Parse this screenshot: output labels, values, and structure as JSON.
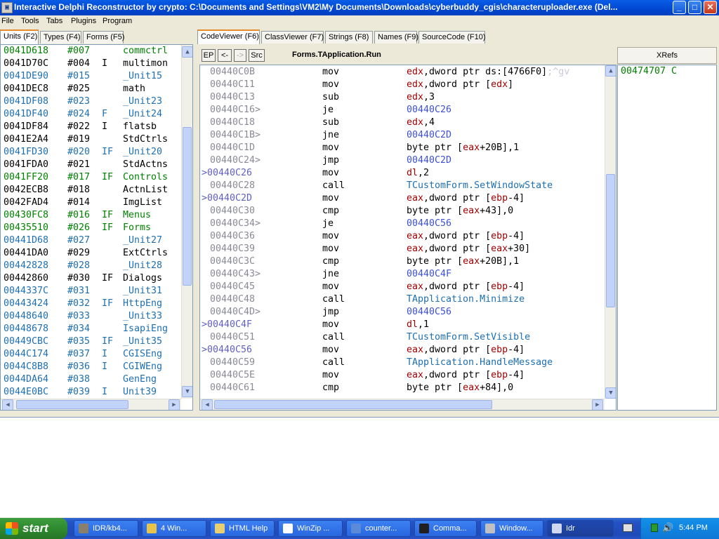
{
  "window": {
    "title": "Interactive Delphi Reconstructor by crypto: C:\\Documents and Settings\\VM2\\My Documents\\Downloads\\cyberbuddy_cgis\\characteruploader.exe (Del...",
    "minimize": "_",
    "maximize": "□",
    "close": "✕"
  },
  "menu": [
    "File",
    "Tools",
    "Tabs",
    "Plugins",
    "Program"
  ],
  "left_tabs": [
    "Units (F2)",
    "Types (F4)",
    "Forms (F5)"
  ],
  "units": [
    {
      "addr": "0041D618",
      "num": "#007",
      "flag": " ",
      "name": "commctrl",
      "color": "#008000"
    },
    {
      "addr": "0041D70C",
      "num": "#004",
      "flag": "I",
      "name": "multimon",
      "color": "#000000"
    },
    {
      "addr": "0041DE90",
      "num": "#015",
      "flag": " ",
      "name": "_Unit15",
      "color": "#1e6fb0"
    },
    {
      "addr": "0041DEC8",
      "num": "#025",
      "flag": " ",
      "name": "math",
      "color": "#000000"
    },
    {
      "addr": "0041DF08",
      "num": "#023",
      "flag": " ",
      "name": "_Unit23",
      "color": "#1e6fb0"
    },
    {
      "addr": "0041DF40",
      "num": "#024",
      "flag": "F",
      "name": "_Unit24",
      "color": "#1e6fb0"
    },
    {
      "addr": "0041DF84",
      "num": "#022",
      "flag": "I",
      "name": "flatsb",
      "color": "#000000"
    },
    {
      "addr": "0041E2A4",
      "num": "#019",
      "flag": " ",
      "name": "StdCtrls",
      "color": "#000000"
    },
    {
      "addr": "0041FD30",
      "num": "#020",
      "flag": "IF",
      "name": "_Unit20",
      "color": "#1e6fb0"
    },
    {
      "addr": "0041FDA0",
      "num": "#021",
      "flag": " ",
      "name": "StdActns",
      "color": "#000000"
    },
    {
      "addr": "0041FF20",
      "num": "#017",
      "flag": "IF",
      "name": "Controls",
      "color": "#008000"
    },
    {
      "addr": "0042ECB8",
      "num": "#018",
      "flag": " ",
      "name": "ActnList",
      "color": "#000000"
    },
    {
      "addr": "0042FAD4",
      "num": "#014",
      "flag": " ",
      "name": "ImgList",
      "color": "#000000"
    },
    {
      "addr": "00430FC8",
      "num": "#016",
      "flag": "IF",
      "name": "Menus",
      "color": "#008000"
    },
    {
      "addr": "00435510",
      "num": "#026",
      "flag": "IF",
      "name": "Forms",
      "color": "#008000"
    },
    {
      "addr": "00441D68",
      "num": "#027",
      "flag": " ",
      "name": "_Unit27",
      "color": "#1e6fb0"
    },
    {
      "addr": "00441DA0",
      "num": "#029",
      "flag": " ",
      "name": "ExtCtrls",
      "color": "#000000"
    },
    {
      "addr": "00442828",
      "num": "#028",
      "flag": " ",
      "name": "_Unit28",
      "color": "#1e6fb0"
    },
    {
      "addr": "00442860",
      "num": "#030",
      "flag": "IF",
      "name": "Dialogs",
      "color": "#000000"
    },
    {
      "addr": "0044337C",
      "num": "#031",
      "flag": " ",
      "name": "_Unit31",
      "color": "#1e6fb0"
    },
    {
      "addr": "00443424",
      "num": "#032",
      "flag": "IF",
      "name": "HttpEng",
      "color": "#1e6fb0"
    },
    {
      "addr": "00448640",
      "num": "#033",
      "flag": " ",
      "name": "_Unit33",
      "color": "#1e6fb0"
    },
    {
      "addr": "00448678",
      "num": "#034",
      "flag": " ",
      "name": "IsapiEng",
      "color": "#1e6fb0"
    },
    {
      "addr": "00449CBC",
      "num": "#035",
      "flag": "IF",
      "name": "_Unit35",
      "color": "#1e6fb0"
    },
    {
      "addr": "0044C174",
      "num": "#037",
      "flag": "I",
      "name": "CGISEng",
      "color": "#1e6fb0"
    },
    {
      "addr": "0044C8B8",
      "num": "#036",
      "flag": "I",
      "name": "CGIWEng",
      "color": "#1e6fb0"
    },
    {
      "addr": "0044DA64",
      "num": "#038",
      "flag": " ",
      "name": "GenEng",
      "color": "#1e6fb0"
    },
    {
      "addr": "0044E0BC",
      "num": "#039",
      "flag": "I",
      "name": "Unit39",
      "color": "#1e6fb0"
    }
  ],
  "right_tabs": [
    "CodeViewer (F6)",
    "ClassViewer (F7)",
    "Strings (F8)",
    "Names (F9)",
    "SourceCode (F10)"
  ],
  "toolbar": {
    "ep": "EP",
    "back": "<-",
    "fwd": "->",
    "src": "Src",
    "proc_name": "Forms.TApplication.Run"
  },
  "xrefs": {
    "header": "XRefs",
    "items": [
      "00474707 C"
    ]
  },
  "code": [
    {
      "addr": "00440C0B",
      "target": false,
      "op": "mov",
      "args": [
        [
          "reg",
          "edx"
        ],
        [
          "op",
          ",dword ptr "
        ],
        [
          "op",
          "ds:["
        ],
        [
          "num",
          "4766F0"
        ],
        [
          "op",
          "]"
        ],
        [
          "dim",
          ";^gv"
        ]
      ]
    },
    {
      "addr": "00440C11",
      "target": false,
      "op": "mov",
      "args": [
        [
          "reg",
          "edx"
        ],
        [
          "op",
          ",dword ptr ["
        ],
        [
          "reg",
          "edx"
        ],
        [
          "op",
          "]"
        ]
      ]
    },
    {
      "addr": "00440C13",
      "target": false,
      "op": "sub",
      "args": [
        [
          "reg",
          "edx"
        ],
        [
          "op",
          ","
        ],
        [
          "num",
          "3"
        ]
      ]
    },
    {
      "addr": "00440C16>",
      "target": false,
      "op": "je",
      "args": [
        [
          "lbl",
          "00440C26"
        ]
      ]
    },
    {
      "addr": "00440C18",
      "target": false,
      "op": "sub",
      "args": [
        [
          "reg",
          "edx"
        ],
        [
          "op",
          ","
        ],
        [
          "num",
          "4"
        ]
      ]
    },
    {
      "addr": "00440C1B>",
      "target": false,
      "op": "jne",
      "args": [
        [
          "lbl",
          "00440C2D"
        ]
      ]
    },
    {
      "addr": "00440C1D",
      "target": false,
      "op": "mov",
      "args": [
        [
          "op",
          "byte ptr ["
        ],
        [
          "reg",
          "eax"
        ],
        [
          "op",
          "+"
        ],
        [
          "num",
          "20B"
        ],
        [
          "op",
          "],"
        ],
        [
          "num",
          "1"
        ]
      ]
    },
    {
      "addr": "00440C24>",
      "target": false,
      "op": "jmp",
      "args": [
        [
          "lbl",
          "00440C2D"
        ]
      ]
    },
    {
      "addr": ">00440C26",
      "target": true,
      "op": "mov",
      "args": [
        [
          "reg",
          "dl"
        ],
        [
          "op",
          ","
        ],
        [
          "num",
          "2"
        ]
      ]
    },
    {
      "addr": "00440C28",
      "target": false,
      "op": "call",
      "args": [
        [
          "call",
          "TCustomForm.SetWindowState"
        ]
      ]
    },
    {
      "addr": ">00440C2D",
      "target": true,
      "op": "mov",
      "args": [
        [
          "reg",
          "eax"
        ],
        [
          "op",
          ",dword ptr ["
        ],
        [
          "reg",
          "ebp"
        ],
        [
          "op",
          "-"
        ],
        [
          "num",
          "4"
        ],
        [
          "op",
          "]"
        ]
      ]
    },
    {
      "addr": "00440C30",
      "target": false,
      "op": "cmp",
      "args": [
        [
          "op",
          "byte ptr ["
        ],
        [
          "reg",
          "eax"
        ],
        [
          "op",
          "+"
        ],
        [
          "num",
          "43"
        ],
        [
          "op",
          "],"
        ],
        [
          "num",
          "0"
        ]
      ]
    },
    {
      "addr": "00440C34>",
      "target": false,
      "op": "je",
      "args": [
        [
          "lbl",
          "00440C56"
        ]
      ]
    },
    {
      "addr": "00440C36",
      "target": false,
      "op": "mov",
      "args": [
        [
          "reg",
          "eax"
        ],
        [
          "op",
          ",dword ptr ["
        ],
        [
          "reg",
          "ebp"
        ],
        [
          "op",
          "-"
        ],
        [
          "num",
          "4"
        ],
        [
          "op",
          "]"
        ]
      ]
    },
    {
      "addr": "00440C39",
      "target": false,
      "op": "mov",
      "args": [
        [
          "reg",
          "eax"
        ],
        [
          "op",
          ",dword ptr ["
        ],
        [
          "reg",
          "eax"
        ],
        [
          "op",
          "+"
        ],
        [
          "num",
          "30"
        ],
        [
          "op",
          "]"
        ]
      ]
    },
    {
      "addr": "00440C3C",
      "target": false,
      "op": "cmp",
      "args": [
        [
          "op",
          "byte ptr ["
        ],
        [
          "reg",
          "eax"
        ],
        [
          "op",
          "+"
        ],
        [
          "num",
          "20B"
        ],
        [
          "op",
          "],"
        ],
        [
          "num",
          "1"
        ]
      ]
    },
    {
      "addr": "00440C43>",
      "target": false,
      "op": "jne",
      "args": [
        [
          "lbl",
          "00440C4F"
        ]
      ]
    },
    {
      "addr": "00440C45",
      "target": false,
      "op": "mov",
      "args": [
        [
          "reg",
          "eax"
        ],
        [
          "op",
          ",dword ptr ["
        ],
        [
          "reg",
          "ebp"
        ],
        [
          "op",
          "-"
        ],
        [
          "num",
          "4"
        ],
        [
          "op",
          "]"
        ]
      ]
    },
    {
      "addr": "00440C48",
      "target": false,
      "op": "call",
      "args": [
        [
          "call",
          "TApplication.Minimize"
        ]
      ]
    },
    {
      "addr": "00440C4D>",
      "target": false,
      "op": "jmp",
      "args": [
        [
          "lbl",
          "00440C56"
        ]
      ]
    },
    {
      "addr": ">00440C4F",
      "target": true,
      "op": "mov",
      "args": [
        [
          "reg",
          "dl"
        ],
        [
          "op",
          ","
        ],
        [
          "num",
          "1"
        ]
      ]
    },
    {
      "addr": "00440C51",
      "target": false,
      "op": "call",
      "args": [
        [
          "call",
          "TCustomForm.SetVisible"
        ]
      ]
    },
    {
      "addr": ">00440C56",
      "target": true,
      "op": "mov",
      "args": [
        [
          "reg",
          "eax"
        ],
        [
          "op",
          ",dword ptr ["
        ],
        [
          "reg",
          "ebp"
        ],
        [
          "op",
          "-"
        ],
        [
          "num",
          "4"
        ],
        [
          "op",
          "]"
        ]
      ]
    },
    {
      "addr": "00440C59",
      "target": false,
      "op": "call",
      "args": [
        [
          "call",
          "TApplication.HandleMessage"
        ]
      ]
    },
    {
      "addr": "00440C5E",
      "target": false,
      "op": "mov",
      "args": [
        [
          "reg",
          "eax"
        ],
        [
          "op",
          ",dword ptr ["
        ],
        [
          "reg",
          "ebp"
        ],
        [
          "op",
          "-"
        ],
        [
          "num",
          "4"
        ],
        [
          "op",
          "]"
        ]
      ]
    },
    {
      "addr": "00440C61",
      "target": false,
      "op": "cmp",
      "args": [
        [
          "op",
          "byte ptr ["
        ],
        [
          "reg",
          "eax"
        ],
        [
          "op",
          "+"
        ],
        [
          "num",
          "84"
        ],
        [
          "op",
          "],"
        ],
        [
          "num",
          "0"
        ]
      ]
    }
  ],
  "taskbar": {
    "start": "start",
    "tasks": [
      {
        "label": "IDR/kb4...",
        "icon": "#8a7f6a"
      },
      {
        "label": "4 Win...",
        "icon": "#e8c44a"
      },
      {
        "label": "HTML Help",
        "icon": "#e8d070"
      },
      {
        "label": "WinZip ...",
        "icon": "#ffffff"
      },
      {
        "label": "counter...",
        "icon": "#5a8ad8"
      },
      {
        "label": "Comma...",
        "icon": "#202020"
      },
      {
        "label": "Window...",
        "icon": "#c0c0c0"
      },
      {
        "label": "Idr",
        "icon": "#d0d8f0"
      }
    ],
    "clock": "5:44 PM"
  },
  "colors": {
    "accent": "#0a5de6",
    "tab_active_border": "#e68b2c",
    "code_reg": "#a00000",
    "code_label": "#3c50d0",
    "code_call": "#1e6fb0"
  }
}
